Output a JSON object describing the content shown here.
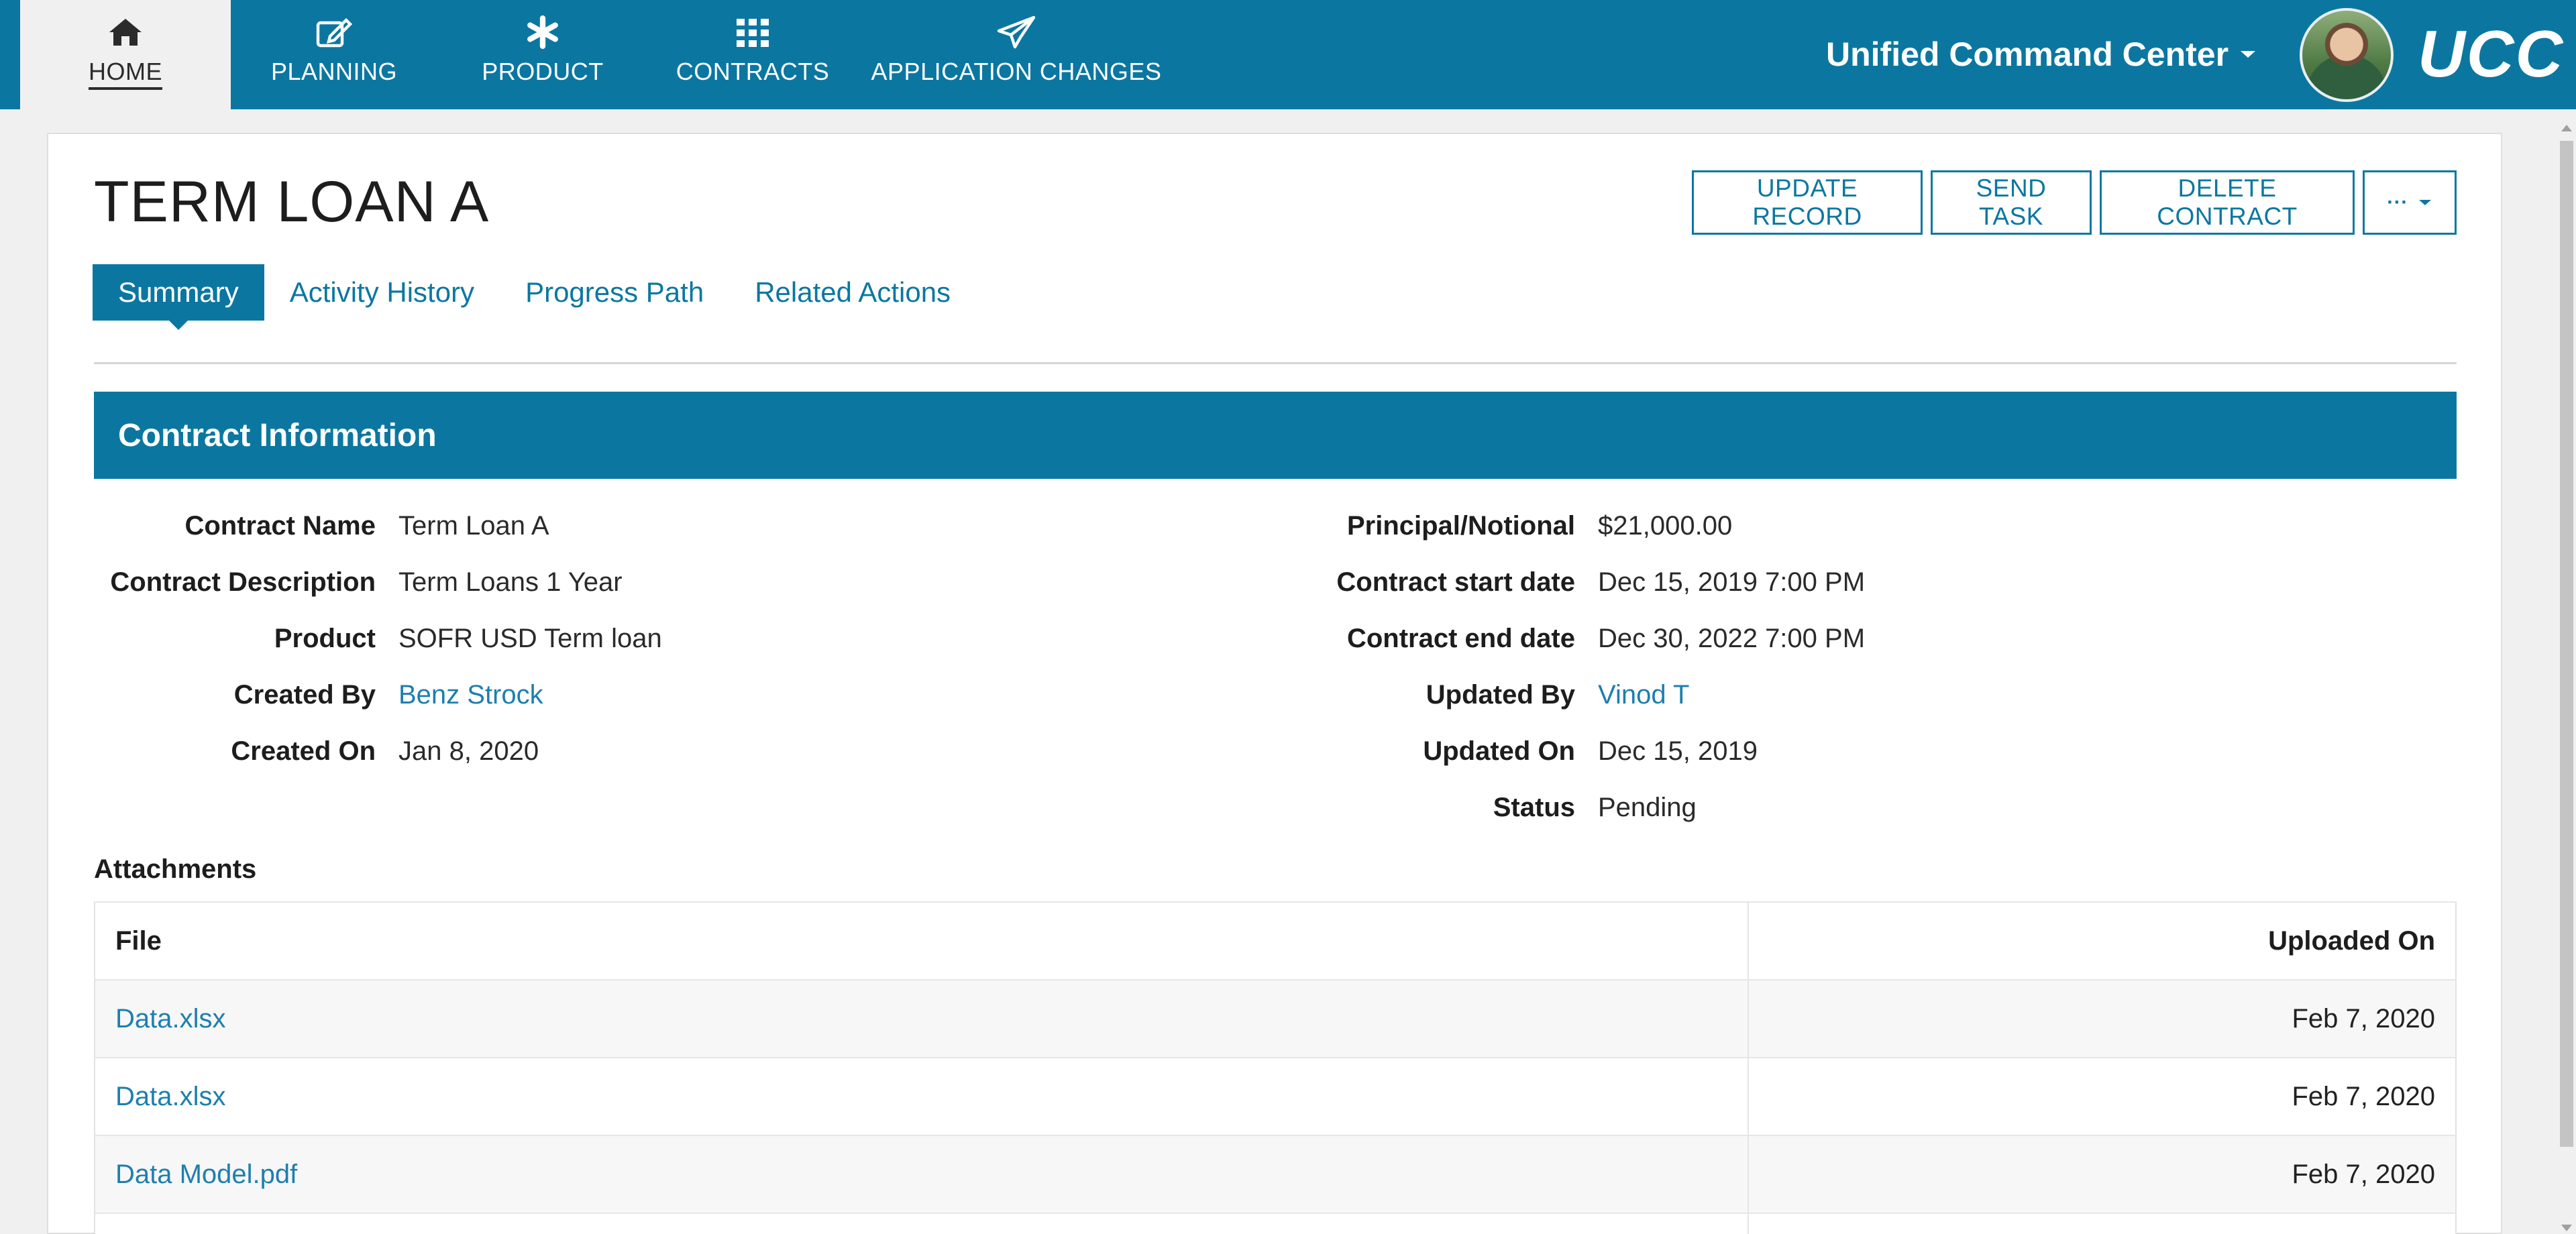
{
  "nav": {
    "tabs": [
      {
        "label": "HOME",
        "icon": "home-icon",
        "active": true
      },
      {
        "label": "PLANNING",
        "icon": "edit-icon"
      },
      {
        "label": "PRODUCT",
        "icon": "asterisk-icon"
      },
      {
        "label": "CONTRACTS",
        "icon": "grid-icon"
      },
      {
        "label": "APPLICATION CHANGES",
        "icon": "paper-plane-icon"
      }
    ],
    "app_name": "Unified Command Center",
    "logo_text": "UCC"
  },
  "page": {
    "title": "TERM LOAN A",
    "actions": {
      "update": "UPDATE RECORD",
      "send_task": "SEND TASK",
      "delete": "DELETE CONTRACT",
      "more": "···"
    },
    "tabs": [
      "Summary",
      "Activity History",
      "Progress Path",
      "Related Actions"
    ]
  },
  "section": {
    "title": "Contract Information"
  },
  "fields": {
    "left": [
      {
        "label": "Contract Name",
        "value": "Term Loan A"
      },
      {
        "label": "Contract Description",
        "value": "Term Loans 1 Year"
      },
      {
        "label": "Product",
        "value": "SOFR USD Term loan"
      },
      {
        "label": "Created By",
        "value": "Benz Strock"
      },
      {
        "label": "Created On",
        "value": "Jan 8, 2020"
      }
    ],
    "right": [
      {
        "label": "Principal/Notional",
        "value": "$21,000.00"
      },
      {
        "label": "Contract start date",
        "value": "Dec 15, 2019 7:00 PM"
      },
      {
        "label": "Contract end date",
        "value": "Dec 30, 2022 7:00 PM"
      },
      {
        "label": "Updated By",
        "value": "Vinod T"
      },
      {
        "label": "Updated On",
        "value": "Dec 15, 2019"
      },
      {
        "label": "Status",
        "value": "Pending"
      }
    ]
  },
  "attachments": {
    "title": "Attachments",
    "columns": [
      "File",
      "Uploaded On"
    ],
    "rows": [
      {
        "file": "Data.xlsx",
        "uploaded": "Feb 7, 2020"
      },
      {
        "file": "Data.xlsx",
        "uploaded": "Feb 7, 2020"
      },
      {
        "file": "Data Model.pdf",
        "uploaded": "Feb 7, 2020"
      },
      {
        "file": "",
        "uploaded": ""
      }
    ]
  },
  "colors": {
    "primary": "#0b77a1",
    "link": "#1d7fae"
  }
}
